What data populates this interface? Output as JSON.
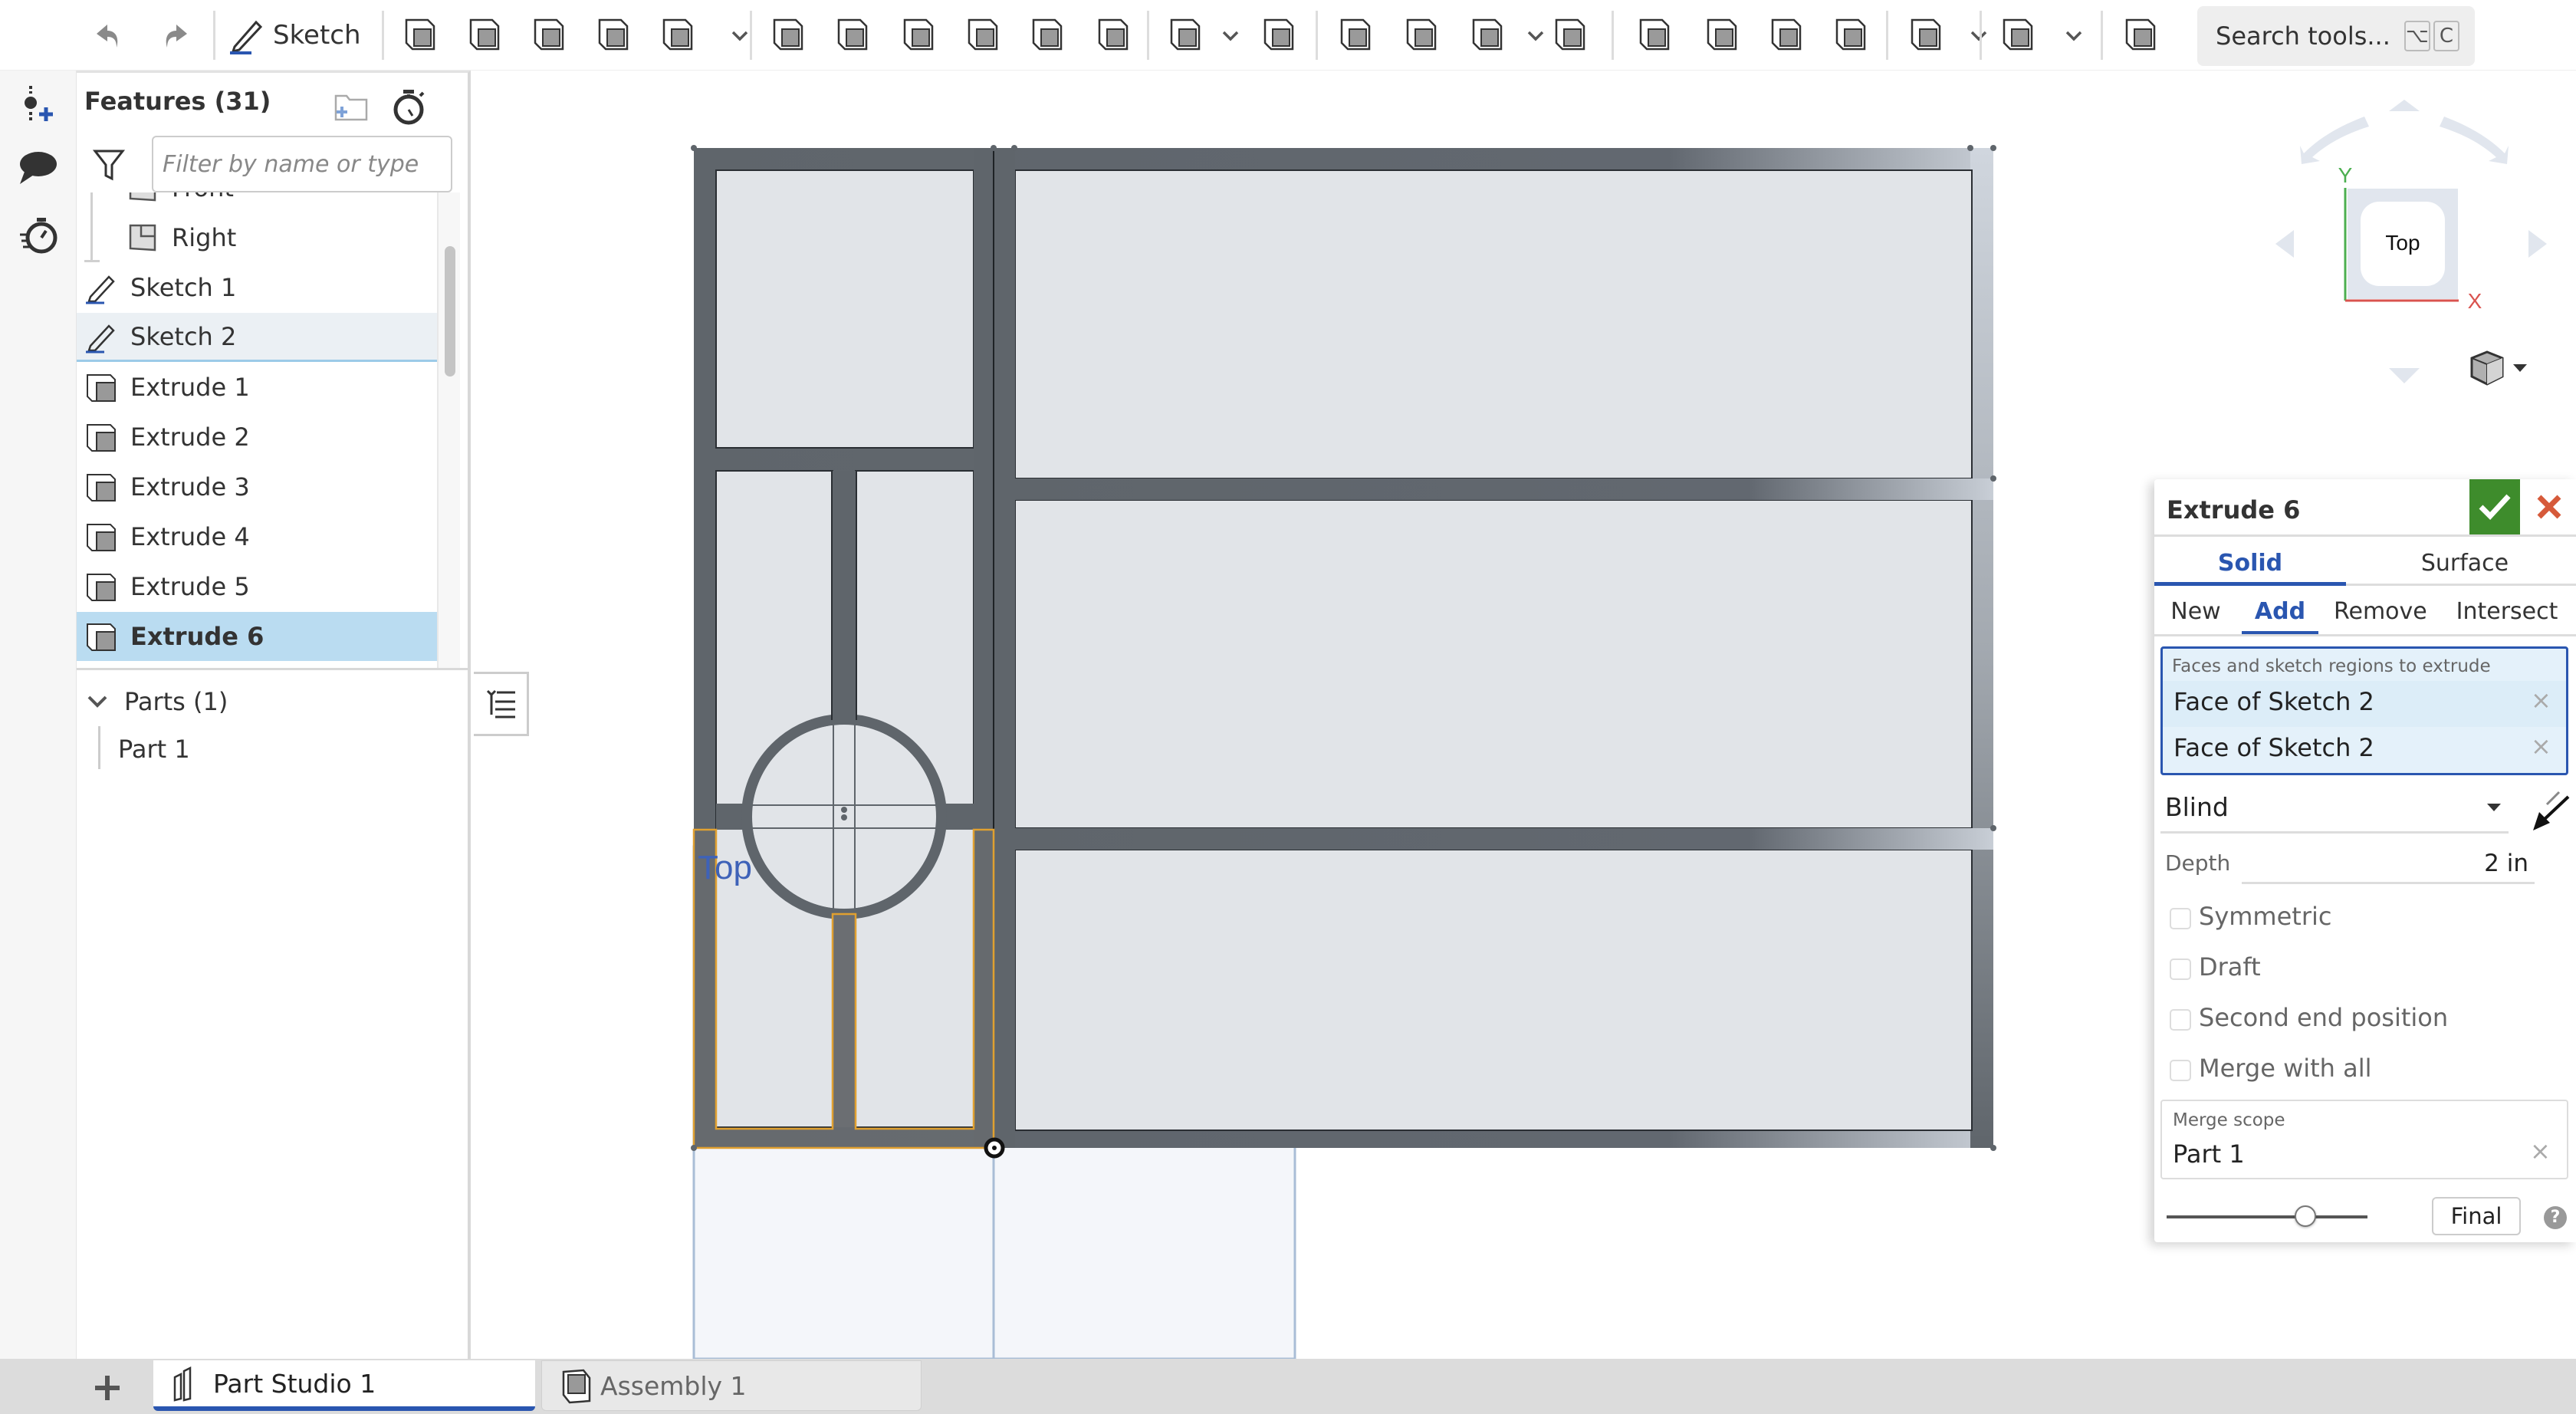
{
  "toolbar": {
    "sketch_label": "Sketch",
    "search_label": "Search tools...",
    "search_kbd": [
      "⌥",
      "C"
    ],
    "tools": [
      "extrude",
      "revolve",
      "sweep",
      "loft",
      "thicken",
      "fillet",
      "chamfer",
      "draft",
      "rib",
      "shell",
      "hole",
      "linear-pattern",
      "mirror",
      "boolean",
      "split",
      "transform",
      "delete-part",
      "modify-fillet",
      "delete-face",
      "move-face",
      "replace-face",
      "plane",
      "sheet-metal",
      "add-custom-feature"
    ]
  },
  "features": {
    "title": "Features (31)",
    "filter_placeholder": "Filter by name or type",
    "items": [
      {
        "label": "Front",
        "type": "plane"
      },
      {
        "label": "Right",
        "type": "plane"
      },
      {
        "label": "Sketch 1",
        "type": "sketch"
      },
      {
        "label": "Sketch 2",
        "type": "sketch",
        "state": "hover"
      },
      {
        "label": "Extrude 1",
        "type": "extrude"
      },
      {
        "label": "Extrude 2",
        "type": "extrude"
      },
      {
        "label": "Extrude 3",
        "type": "extrude"
      },
      {
        "label": "Extrude 4",
        "type": "extrude"
      },
      {
        "label": "Extrude 5",
        "type": "extrude"
      },
      {
        "label": "Extrude 6",
        "type": "extrude",
        "state": "selected"
      }
    ],
    "parts_title": "Parts (1)",
    "parts": [
      "Part 1"
    ]
  },
  "viewcube": {
    "face_label": "Top",
    "x_axis": "X",
    "y_axis": "Y",
    "colors": {
      "x": "#d9534f",
      "y": "#4caf50"
    }
  },
  "viewport": {
    "plane_label": "Top",
    "highlight_color": "#e0a030",
    "model_color": "#5f656b"
  },
  "extrude_dialog": {
    "title": "Extrude 6",
    "type_tabs": [
      {
        "label": "Solid",
        "active": true
      },
      {
        "label": "Surface",
        "active": false
      }
    ],
    "op_tabs": [
      {
        "label": "New",
        "active": false
      },
      {
        "label": "Add",
        "active": true
      },
      {
        "label": "Remove",
        "active": false
      },
      {
        "label": "Intersect",
        "active": false
      }
    ],
    "selection_label": "Faces and sketch regions to extrude",
    "selections": [
      "Face of Sketch 2",
      "Face of Sketch 2"
    ],
    "end_type": "Blind",
    "depth_label": "Depth",
    "depth_value": "2 in",
    "options": [
      {
        "label": "Symmetric",
        "checked": false
      },
      {
        "label": "Draft",
        "checked": false
      },
      {
        "label": "Second end position",
        "checked": false
      },
      {
        "label": "Merge with all",
        "checked": false
      }
    ],
    "merge_scope_label": "Merge scope",
    "merge_scope_value": "Part 1",
    "rollback_fraction": 0.69,
    "final_label": "Final",
    "accent": "#2a56b0",
    "ok_color": "#3e8c2c",
    "cancel_color": "#d65a3a"
  },
  "tabs": [
    {
      "label": "Part Studio 1",
      "active": true
    },
    {
      "label": "Assembly 1",
      "active": false
    }
  ]
}
